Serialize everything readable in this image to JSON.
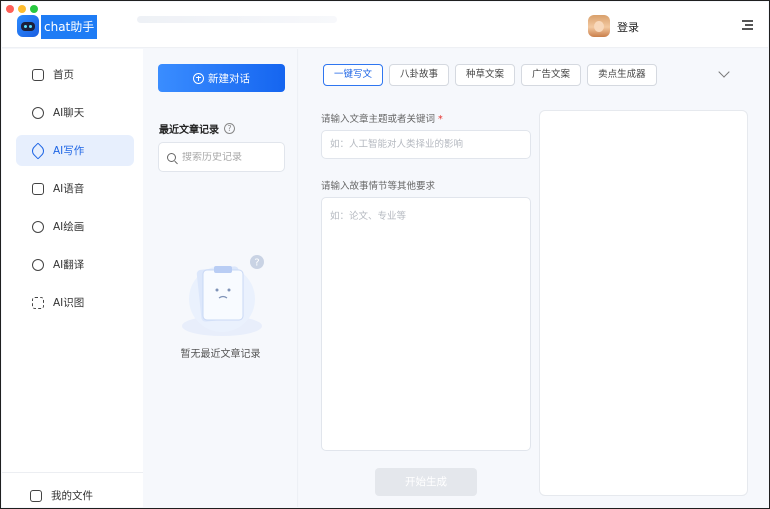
{
  "app": {
    "title": "chat助手"
  },
  "header": {
    "login_label": "登录"
  },
  "sidebar": {
    "items": [
      {
        "label": "首页",
        "icon": "home-icon"
      },
      {
        "label": "AI聊天",
        "icon": "chat-bubble-icon"
      },
      {
        "label": "AI写作",
        "icon": "pen-icon",
        "active": true
      },
      {
        "label": "AI语音",
        "icon": "voice-wave-icon"
      },
      {
        "label": "AI绘画",
        "icon": "palette-icon"
      },
      {
        "label": "AI翻译",
        "icon": "translate-icon"
      },
      {
        "label": "AI识图",
        "icon": "image-scan-icon"
      }
    ],
    "files_label": "我的文件"
  },
  "history": {
    "new_chat_label": "新建对话",
    "recent_title": "最近文章记录",
    "search_placeholder": "搜索历史记录",
    "empty_text": "暂无最近文章记录"
  },
  "writing": {
    "tabs": [
      "一键写文",
      "八卦故事",
      "种草文案",
      "广告文案",
      "卖点生成器"
    ],
    "active_tab": "一键写文",
    "topic_label": "请输入文章主题或者关键词",
    "required_mark": "*",
    "topic_placeholder": "如：人工智能对人类择业的影响",
    "story_label": "请输入故事情节等其他要求",
    "story_placeholder": "如：论文、专业等",
    "generate_label": "开始生成"
  },
  "colors": {
    "accent": "#1f66e5",
    "active_bg": "#e7effd",
    "button_gradient_start": "#3a8dff",
    "button_gradient_end": "#1565f0",
    "disabled_button": "#e4e7ec",
    "required": "#e5322d"
  }
}
